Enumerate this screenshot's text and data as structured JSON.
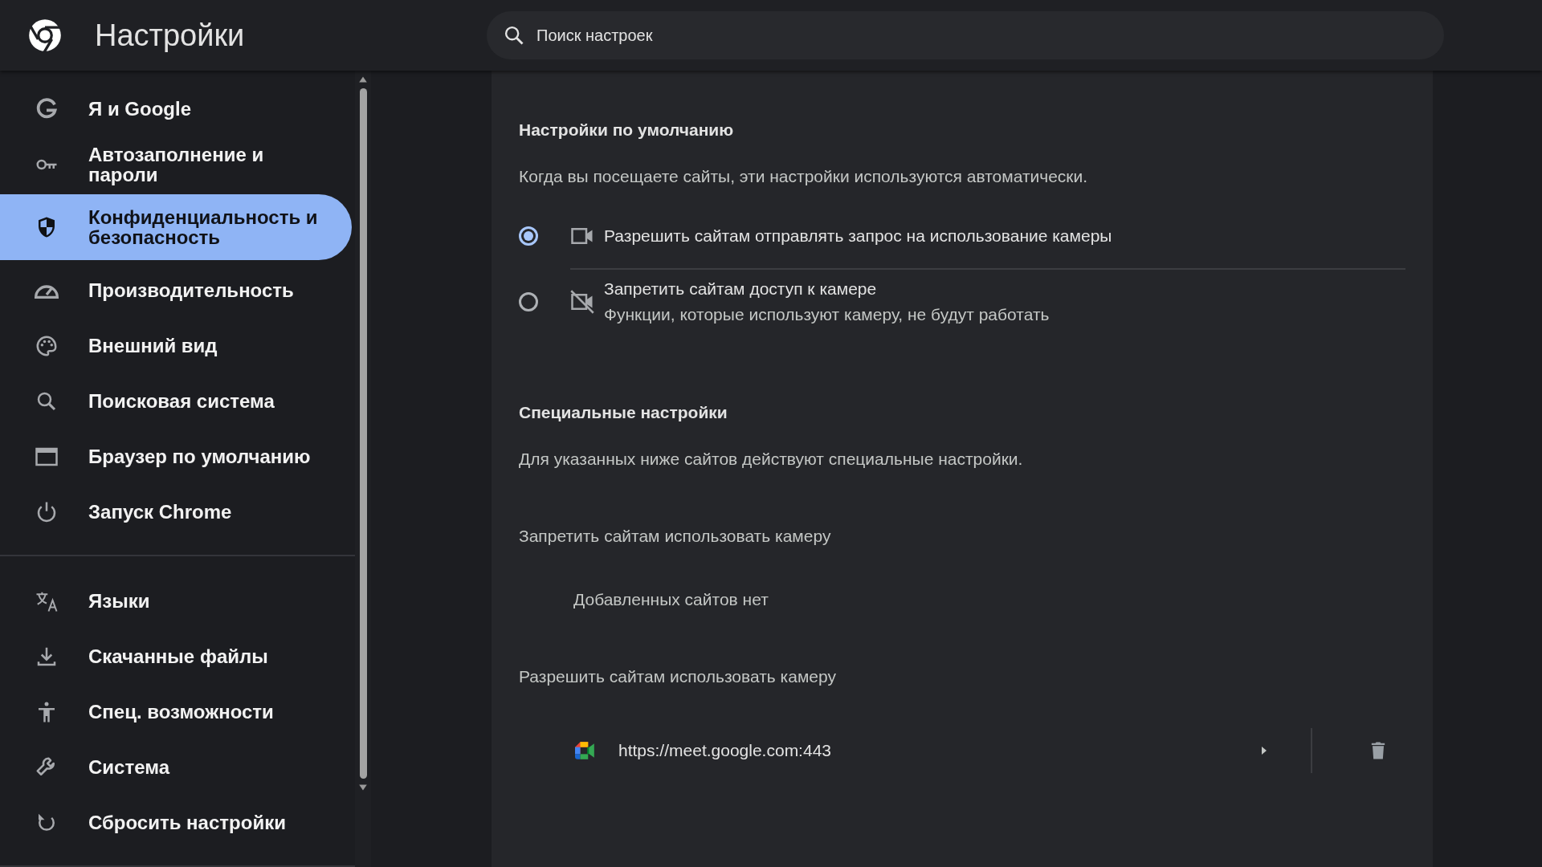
{
  "header": {
    "title": "Настройки",
    "search": {
      "placeholder": "Поиск настроек"
    }
  },
  "sidebar": {
    "groups": [
      {
        "items": [
          {
            "label": "Я и Google",
            "selected": false
          },
          {
            "label": "Автозаполнение и пароли",
            "selected": false
          },
          {
            "label": "Конфиденциальность и безопасность",
            "selected": true
          },
          {
            "label": "Производительность",
            "selected": false
          },
          {
            "label": "Внешний вид",
            "selected": false
          },
          {
            "label": "Поисковая система",
            "selected": false
          },
          {
            "label": "Браузер по умолчанию",
            "selected": false
          },
          {
            "label": "Запуск Chrome",
            "selected": false
          }
        ]
      },
      {
        "items": [
          {
            "label": "Языки",
            "selected": false
          },
          {
            "label": "Скачанные файлы",
            "selected": false
          },
          {
            "label": "Спец. возможности",
            "selected": false
          },
          {
            "label": "Система",
            "selected": false
          },
          {
            "label": "Сбросить настройки",
            "selected": false
          }
        ]
      }
    ]
  },
  "default_section": {
    "heading": "Настройки по умолчанию",
    "description": "Когда вы посещаете сайты, эти настройки используются автоматически.",
    "options": [
      {
        "label": "Разрешить сайтам отправлять запрос на использование камеры",
        "selected": true
      },
      {
        "label": "Запретить сайтам доступ к камере",
        "sublabel": "Функции, которые используют камеру, не будут работать",
        "selected": false
      }
    ]
  },
  "custom_section": {
    "heading": "Специальные настройки",
    "description": "Для указанных ниже сайтов действуют специальные настройки.",
    "lists": [
      {
        "heading": "Запретить сайтам использовать камеру",
        "empty_text": "Добавленных сайтов нет"
      },
      {
        "heading": "Разрешить сайтам использовать камеру",
        "sites": [
          {
            "url": "https://meet.google.com:443"
          }
        ]
      }
    ]
  }
}
